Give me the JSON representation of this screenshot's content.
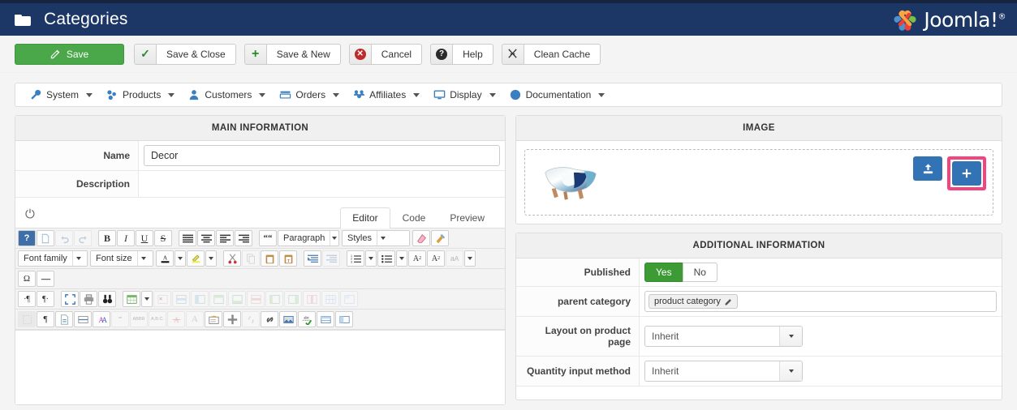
{
  "header": {
    "title": "Categories",
    "folder_icon": "folder-icon",
    "logo_text": "Joomla!",
    "logo_sup": "®",
    "bg_color": "#1c3765"
  },
  "toolbar": {
    "save_label": "Save",
    "save_color": "#4aa84a",
    "buttons": [
      {
        "icon": "check-icon",
        "label": "Save & Close"
      },
      {
        "icon": "plus-icon",
        "label": "Save & New"
      },
      {
        "icon": "cancel-icon",
        "label": "Cancel"
      },
      {
        "icon": "question-icon",
        "label": "Help"
      },
      {
        "icon": "broom-icon",
        "label": "Clean Cache"
      }
    ]
  },
  "nav": {
    "items": [
      {
        "icon": "wrench-icon",
        "label": "System"
      },
      {
        "icon": "products-icon",
        "label": "Products"
      },
      {
        "icon": "user-icon",
        "label": "Customers"
      },
      {
        "icon": "orders-icon",
        "label": "Orders"
      },
      {
        "icon": "affiliates-icon",
        "label": "Affiliates"
      },
      {
        "icon": "display-icon",
        "label": "Display"
      },
      {
        "icon": "documentation-icon",
        "label": "Documentation"
      }
    ]
  },
  "main_information": {
    "panel_title": "MAIN INFORMATION",
    "name_label": "Name",
    "name_value": "Decor",
    "description_label": "Description",
    "power_icon": "power-toggle-icon",
    "editor_tabs": [
      {
        "label": "Editor",
        "active": true
      },
      {
        "label": "Code",
        "active": false
      },
      {
        "label": "Preview",
        "active": false
      }
    ],
    "editor_selects": {
      "font_family": "Font family",
      "font_size": "Font size",
      "paragraph": "Paragraph",
      "styles": "Styles"
    },
    "editor_content": ""
  },
  "image_panel": {
    "panel_title": "IMAGE",
    "thumbnail_alt": "ceramic-bowl-thumbnail",
    "upload_button_icon": "upload-icon",
    "add_button_icon": "plus-icon",
    "highlight_color": "#f2447e",
    "button_color": "#3273b5"
  },
  "additional_information": {
    "panel_title": "ADDITIONAL INFORMATION",
    "rows": [
      {
        "label": "Published",
        "type": "toggle",
        "options": [
          "Yes",
          "No"
        ],
        "selected": "Yes"
      },
      {
        "label": "parent category",
        "type": "tags",
        "tags": [
          "product category"
        ]
      },
      {
        "label": "Layout on product page",
        "type": "select",
        "value": "Inherit"
      },
      {
        "label": "Quantity input method",
        "type": "select",
        "value": "Inherit"
      }
    ]
  }
}
